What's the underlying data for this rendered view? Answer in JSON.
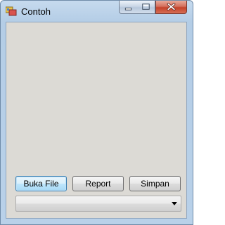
{
  "window": {
    "title": "Contoh",
    "icon": "application-icon",
    "caption_buttons": [
      "minimize-icon",
      "maximize-icon",
      "close-icon"
    ]
  },
  "form": {
    "buttons": {
      "open_file": "Buka File",
      "report": "Report",
      "save": "Simpan"
    },
    "combo": {
      "value": "",
      "icon": "chevron-down-icon"
    }
  },
  "colors": {
    "client_background": "#dcdad5",
    "close_button": "#c4412a",
    "frame": "#b9d1e9"
  }
}
